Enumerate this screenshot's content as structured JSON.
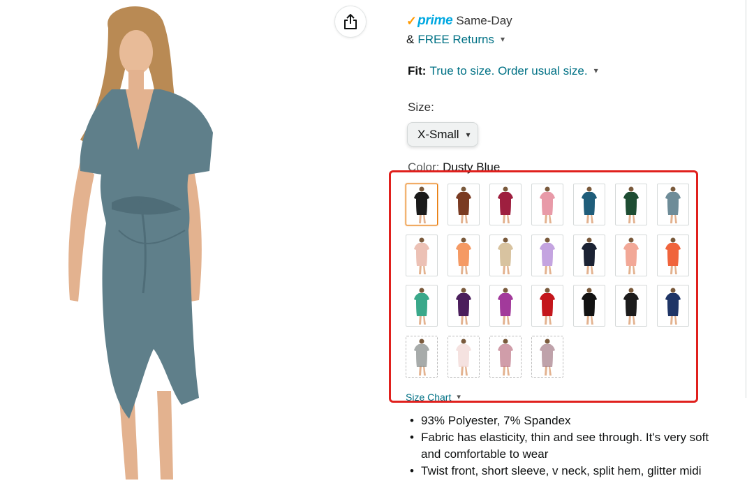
{
  "product": {
    "image_alt": "Woman wearing a dusty blue twist front midi dress",
    "dress_color": "#5f7f8a"
  },
  "share_icon": "share-icon",
  "delivery": {
    "prime_check": "✓",
    "prime_word": "prime",
    "same_day": "Same-Day",
    "amp": "&",
    "free_returns": "FREE Returns"
  },
  "fit": {
    "label": "Fit:",
    "value": "True to size. Order usual size."
  },
  "size": {
    "label": "Size:",
    "selected": "X-Small"
  },
  "color": {
    "label": "Color:",
    "value": "Dusty Blue"
  },
  "swatches": [
    {
      "name": "black",
      "color": "#1a1a1a",
      "selected": true,
      "available": true
    },
    {
      "name": "brown",
      "color": "#7a3b22",
      "selected": false,
      "available": true
    },
    {
      "name": "wine",
      "color": "#9e1f3f",
      "selected": false,
      "available": true
    },
    {
      "name": "pink",
      "color": "#e89aa8",
      "selected": false,
      "available": true
    },
    {
      "name": "teal-blue",
      "color": "#1f5d7a",
      "selected": false,
      "available": true
    },
    {
      "name": "dark-green",
      "color": "#1e4d33",
      "selected": false,
      "available": true
    },
    {
      "name": "dusty-blue",
      "color": "#6e8c98",
      "selected": false,
      "available": true
    },
    {
      "name": "light-pink",
      "color": "#ecc1b5",
      "selected": false,
      "available": true
    },
    {
      "name": "orange",
      "color": "#f59a64",
      "selected": false,
      "available": true
    },
    {
      "name": "khaki",
      "color": "#d8c3a0",
      "selected": false,
      "available": true
    },
    {
      "name": "lavender",
      "color": "#c4a4e0",
      "selected": false,
      "available": true
    },
    {
      "name": "navy-black",
      "color": "#1b2233",
      "selected": false,
      "available": true
    },
    {
      "name": "peach",
      "color": "#f2a897",
      "selected": false,
      "available": true
    },
    {
      "name": "coral",
      "color": "#f0643c",
      "selected": false,
      "available": true
    },
    {
      "name": "green",
      "color": "#3aa88a",
      "selected": false,
      "available": true
    },
    {
      "name": "purple",
      "color": "#4b1e5c",
      "selected": false,
      "available": true
    },
    {
      "name": "magenta",
      "color": "#a23a9b",
      "selected": false,
      "available": true
    },
    {
      "name": "red",
      "color": "#c4161c",
      "selected": false,
      "available": true
    },
    {
      "name": "black-2",
      "color": "#121212",
      "selected": false,
      "available": true
    },
    {
      "name": "black-3",
      "color": "#1c1c1c",
      "selected": false,
      "available": true
    },
    {
      "name": "navy",
      "color": "#1f3566",
      "selected": false,
      "available": true
    },
    {
      "name": "grey",
      "color": "#8a8f8e",
      "selected": false,
      "available": false
    },
    {
      "name": "pale-pink",
      "color": "#f1d8d6",
      "selected": false,
      "available": false
    },
    {
      "name": "mauve",
      "color": "#c07c8c",
      "selected": false,
      "available": false
    },
    {
      "name": "rose-grey",
      "color": "#a9838e",
      "selected": false,
      "available": false
    }
  ],
  "size_chart": {
    "label": "Size Chart"
  },
  "bullets": [
    "93% Polyester, 7% Spandex",
    "Fabric has elasticity, thin and see through. It's very soft and comfortable to wear",
    "Twist front, short sleeve, v neck, split hem, glitter midi"
  ],
  "colors": {
    "link": "#007185",
    "highlight": "#e0201d",
    "prime_blue": "#00a8e1",
    "prime_orange": "#ff9900"
  }
}
